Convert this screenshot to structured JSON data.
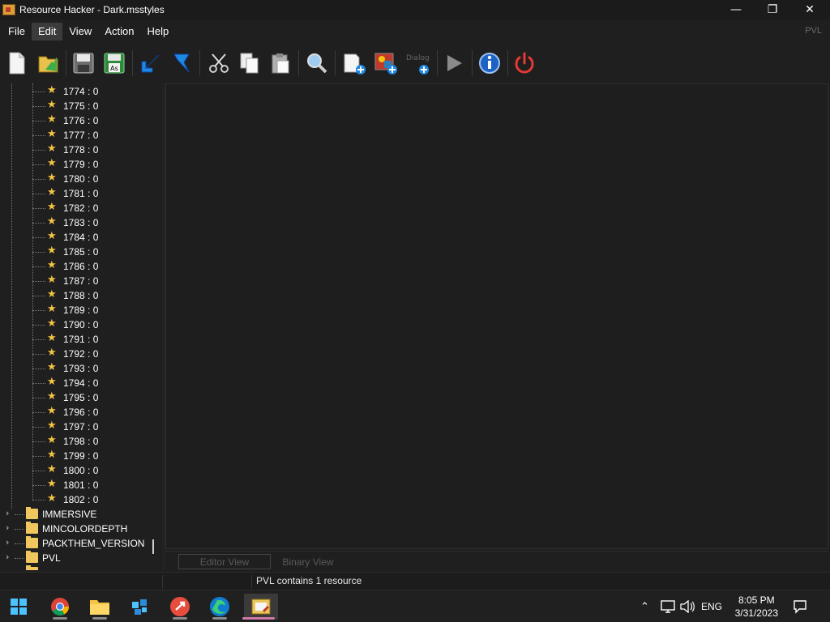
{
  "window": {
    "title": "Resource Hacker - Dark.msstyles",
    "minimize_glyph": "—",
    "restore_glyph": "❐",
    "close_glyph": "✕"
  },
  "menu": {
    "items": [
      "File",
      "Edit",
      "View",
      "Action",
      "Help"
    ],
    "hovered": "Edit",
    "right_label": "PVL"
  },
  "toolbar": {
    "buttons": [
      {
        "name": "new-file-icon"
      },
      {
        "name": "open-file-icon"
      },
      {
        "name": "save-icon"
      },
      {
        "name": "save-as-icon",
        "label": "As"
      },
      {
        "name": "arrow-down-left-icon"
      },
      {
        "name": "bookmark-icon"
      },
      {
        "name": "cut-icon"
      },
      {
        "name": "copy-icon"
      },
      {
        "name": "paste-icon"
      },
      {
        "name": "search-icon"
      },
      {
        "name": "add-resource-icon"
      },
      {
        "name": "add-image-resource-icon"
      },
      {
        "name": "add-dialog-resource-icon",
        "label": "Dialog Merge"
      },
      {
        "name": "play-icon"
      },
      {
        "name": "info-icon"
      },
      {
        "name": "power-icon"
      }
    ]
  },
  "tree": {
    "leaf_items": [
      "1774 : 0",
      "1775 : 0",
      "1776 : 0",
      "1777 : 0",
      "1778 : 0",
      "1779 : 0",
      "1780 : 0",
      "1781 : 0",
      "1782 : 0",
      "1783 : 0",
      "1784 : 0",
      "1785 : 0",
      "1786 : 0",
      "1787 : 0",
      "1788 : 0",
      "1789 : 0",
      "1790 : 0",
      "1791 : 0",
      "1792 : 0",
      "1793 : 0",
      "1794 : 0",
      "1795 : 0",
      "1796 : 0",
      "1797 : 0",
      "1798 : 0",
      "1799 : 0",
      "1800 : 0",
      "1801 : 0",
      "1802 : 0"
    ],
    "folders": [
      "IMMERSIVE",
      "MINCOLORDEPTH",
      "PACKTHEM_VERSION",
      "PVL"
    ],
    "selected_folder": "PVL"
  },
  "editor": {
    "tabs": [
      "Editor View",
      "Binary View"
    ]
  },
  "status": {
    "text": "PVL contains 1 resource"
  },
  "taskbar": {
    "apps": [
      "windows-start-icon",
      "chrome-icon",
      "file-explorer-icon",
      "store-icon",
      "remote-desktop-icon",
      "edge-icon",
      "resource-hacker-icon"
    ],
    "active_app": "resource-hacker-icon",
    "language": "ENG",
    "time": "8:05 PM",
    "date": "3/31/2023"
  },
  "colors": {
    "background": "#1f1f1f",
    "star": "#f4c542",
    "folder": "#f0c75e",
    "accent_blue": "#1e88e5",
    "power_red": "#e53935"
  }
}
